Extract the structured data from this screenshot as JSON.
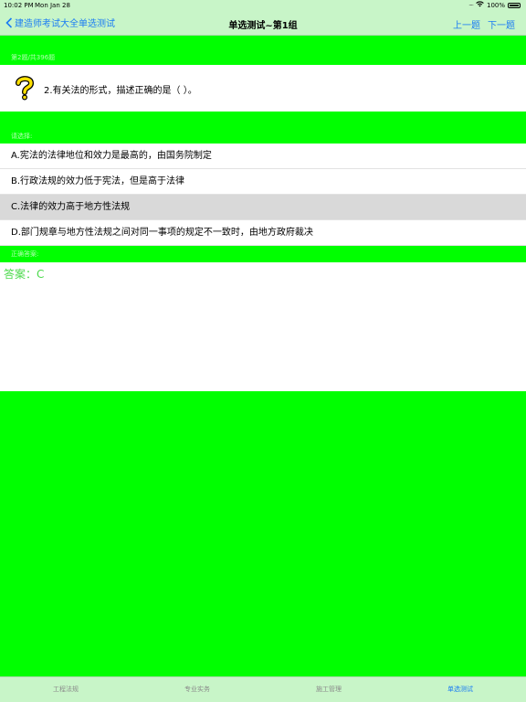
{
  "status_bar": {
    "time": "10:02 PM",
    "date": "Mon Jan 28",
    "battery": "100%"
  },
  "navbar": {
    "back_label": "建造师考试大全单选测试",
    "title": "单选测试~第1组",
    "prev_label": "上一题",
    "next_label": "下一题"
  },
  "question": {
    "section_label": "第2题/共396题",
    "text": "2.有关法的形式，描述正确的是（  ）。",
    "icon": "question-mark-icon"
  },
  "options": {
    "section_label": "请选择:",
    "items": [
      "A.宪法的法律地位和效力是最高的，由国务院制定",
      "B.行政法规的效力低于宪法，但是高于法律",
      "C.法律的效力高于地方性法规",
      "D.部门规章与地方性法规之间对同一事项的规定不一致时，由地方政府裁决"
    ],
    "selected_index": 2
  },
  "answer": {
    "section_label": "正确答案:",
    "text": "答案：C"
  },
  "tabbar": {
    "tabs": [
      "工程法规",
      "专业实务",
      "施工管理",
      "单选测试"
    ],
    "active_index": 3
  },
  "colors": {
    "background": "#00ff00",
    "bar": "#c8f5c8",
    "accent": "#1a7cf4",
    "answer": "#4cd94c",
    "selected_option": "#d9d9d9"
  }
}
